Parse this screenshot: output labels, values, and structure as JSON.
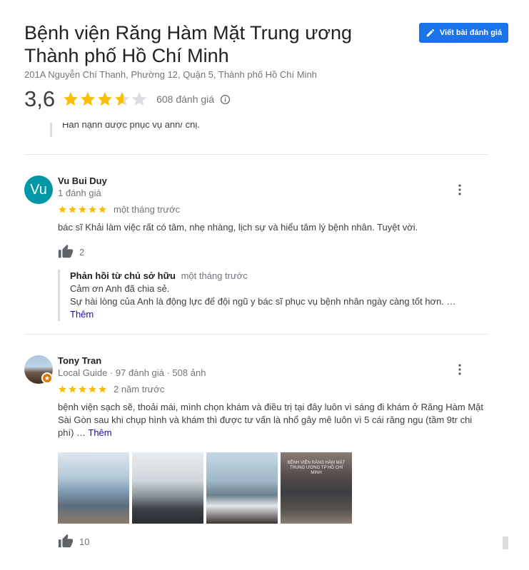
{
  "place": {
    "title_line1": "Bệnh viện Răng Hàm Mặt Trung ương",
    "title_line2": "Thành phố Hồ Chí Minh",
    "address": "201A Nguyễn Chí Thanh, Phường 12, Quận 5, Thành phố Hồ Chí Minh",
    "rating": "3,6",
    "rating_value": 3.6,
    "review_count": "608 đánh giá"
  },
  "write_review_button": "Viết bài đánh giá",
  "clipped_reply_text": "Hân hạnh được phục vụ anh/ chị.",
  "reviews": [
    {
      "avatar_letter": "Vu",
      "name": "Vu Bui Duy",
      "meta": "1 đánh giá",
      "stars": 5,
      "time": "một tháng trước",
      "text": "bác sĩ Khải làm việc rất có tâm, nhẹ nhàng, lịch sự và hiểu tâm lý bệnh nhân. Tuyệt vời.",
      "likes": "2",
      "owner_reply": {
        "label": "Phản hồi từ chủ sở hữu",
        "time": "một tháng trước",
        "line1": "Cảm ơn Anh đã chia sẻ.",
        "line2": "Sự hài lòng của Anh là động lực để đội ngũ y bác sĩ phục vụ bệnh nhân ngày càng tốt hơn. … ",
        "more": "Thêm"
      }
    },
    {
      "name": "Tony Tran",
      "meta": "Local Guide · 97 đánh giá · 508 ảnh",
      "stars": 5,
      "time": "2 năm trước",
      "text": "bệnh viện sạch sẽ, thoải mái, mình chọn khám và điều trị tại đây luôn vì sáng đi khám ở Răng Hàm Mặt Sài Gòn sau khi chụp hình và khám thì được tư vấn là nhổ gây mê luôn vì 5 cái răng ngu (tầm 9tr chi phí) … ",
      "more": "Thêm",
      "photo_sign": "BỆNH VIỆN RĂNG HÀM MẶT TRUNG ƯƠNG TP HỒ CHÍ MINH",
      "likes": "10"
    }
  ],
  "colors": {
    "star": "#fbbc04",
    "star_empty": "#dadce0",
    "button": "#1a73e8",
    "avatar_vu": "#0097a7",
    "link": "#1a0dab"
  },
  "icons": [
    "star-icon",
    "pencil-icon",
    "info-icon",
    "thumbs-up-icon",
    "more-vert-icon",
    "local-guide-badge-icon"
  ]
}
